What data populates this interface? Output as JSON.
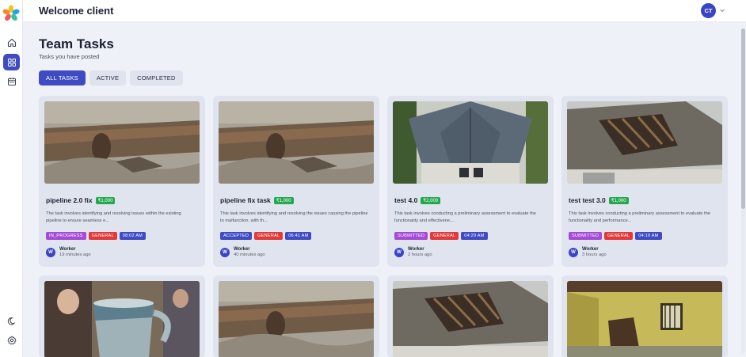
{
  "header": {
    "title": "Welcome client",
    "avatar_initials": "CT"
  },
  "page": {
    "title": "Team Tasks",
    "subtitle": "Tasks you have posted"
  },
  "tabs": [
    {
      "label": "ALL TASKS",
      "active": true
    },
    {
      "label": "ACTIVE",
      "active": false
    },
    {
      "label": "COMPLETED",
      "active": false
    }
  ],
  "cards": [
    {
      "title": "pipeline 2.0 fix",
      "price": "₹1,000",
      "description": "The task involves identifying and resolving issues within the existing pipeline to ensure seamless e...",
      "status": "IN_PROGRESS",
      "category": "GENERAL",
      "time": "08:02 AM",
      "worker_initial": "W",
      "worker": "Worker",
      "posted": "19 minutes ago",
      "image": "pipeline"
    },
    {
      "title": "pipeline fix task",
      "price": "₹1,000",
      "description": "This task involves identifying and resolving the issues causing the pipeline to malfunction, with th...",
      "status": "ACCEPTED",
      "category": "GENERAL",
      "time": "06:41 AM",
      "worker_initial": "W",
      "worker": "Worker",
      "posted": "40 minutes ago",
      "image": "pipeline"
    },
    {
      "title": "test 4.0",
      "price": "₹2,000",
      "description": "This task involves conducting a preliminary assessment to evaluate the functionality and effectivene...",
      "status": "SUBMITTED",
      "category": "GENERAL",
      "time": "04:29 AM",
      "worker_initial": "W",
      "worker": "Worker",
      "posted": "2 hours ago",
      "image": "roof"
    },
    {
      "title": "test test 3.0",
      "price": "₹1,000",
      "description": "This task involves conducting a preliminary assessment to evaluate the functionality and performance...",
      "status": "SUBMITTED",
      "category": "GENERAL",
      "time": "04:10 AM",
      "worker_initial": "W",
      "worker": "Worker",
      "posted": "3 hours ago",
      "image": "damaged-roof"
    }
  ],
  "colors": {
    "accent": "#3f4bc3",
    "price": "#23a84d",
    "status": "#a64bd6",
    "general": "#e23a3a"
  }
}
